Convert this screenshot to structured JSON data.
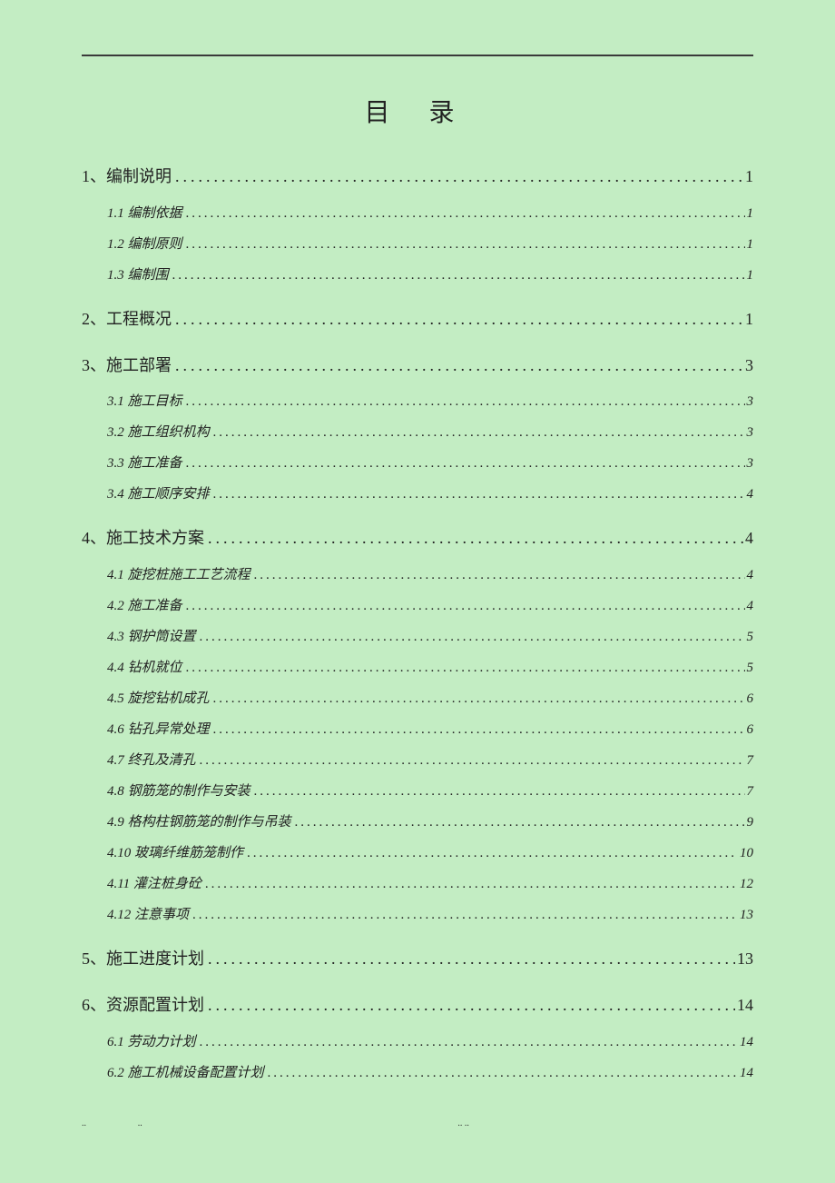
{
  "title": "目 录",
  "toc": [
    {
      "level": 1,
      "label": "1、编制说明",
      "page": "1"
    },
    {
      "level": 2,
      "label": "1.1 编制依据",
      "page": "1"
    },
    {
      "level": 2,
      "label": "1.2 编制原则",
      "page": "1"
    },
    {
      "level": 2,
      "label": "1.3 编制围",
      "page": "1"
    },
    {
      "level": 1,
      "label": "2、工程概况",
      "page": "1"
    },
    {
      "level": 1,
      "label": "3、施工部署",
      "page": "3"
    },
    {
      "level": 2,
      "label": "3.1 施工目标",
      "page": "3"
    },
    {
      "level": 2,
      "label": "3.2 施工组织机构",
      "page": "3"
    },
    {
      "level": 2,
      "label": "3.3 施工准备",
      "page": "3"
    },
    {
      "level": 2,
      "label": "3.4 施工顺序安排",
      "page": "4"
    },
    {
      "level": 1,
      "label": "4、施工技术方案",
      "page": "4"
    },
    {
      "level": 2,
      "label": "4.1 旋挖桩施工工艺流程",
      "page": "4"
    },
    {
      "level": 2,
      "label": "4.2 施工准备",
      "page": "4"
    },
    {
      "level": 2,
      "label": "4.3 钢护筒设置",
      "page": "5"
    },
    {
      "level": 2,
      "label": "4.4 钻机就位",
      "page": "5"
    },
    {
      "level": 2,
      "label": "4.5 旋挖钻机成孔",
      "page": "6"
    },
    {
      "level": 2,
      "label": "4.6 钻孔异常处理",
      "page": "6"
    },
    {
      "level": 2,
      "label": "4.7 终孔及清孔",
      "page": "7"
    },
    {
      "level": 2,
      "label": "4.8 钢筋笼的制作与安装",
      "page": "7"
    },
    {
      "level": 2,
      "label": "4.9 格构柱钢筋笼的制作与吊装",
      "page": "9"
    },
    {
      "level": 2,
      "label": "4.10 玻璃纤维筋笼制作",
      "page": "10"
    },
    {
      "level": 2,
      "label": "4.11 灌注桩身砼",
      "page": "12"
    },
    {
      "level": 2,
      "label": "4.12 注意事项",
      "page": "13"
    },
    {
      "level": 1,
      "label": "5、施工进度计划",
      "page": "13"
    },
    {
      "level": 1,
      "label": "6、资源配置计划",
      "page": "14"
    },
    {
      "level": 2,
      "label": "6.1 劳动力计划",
      "page": "14"
    },
    {
      "level": 2,
      "label": "6.2 施工机械设备配置计划",
      "page": "14"
    }
  ],
  "footer_marks": {
    "left": "..",
    "mid1": "..",
    "mid2": "..",
    "right": ".."
  }
}
